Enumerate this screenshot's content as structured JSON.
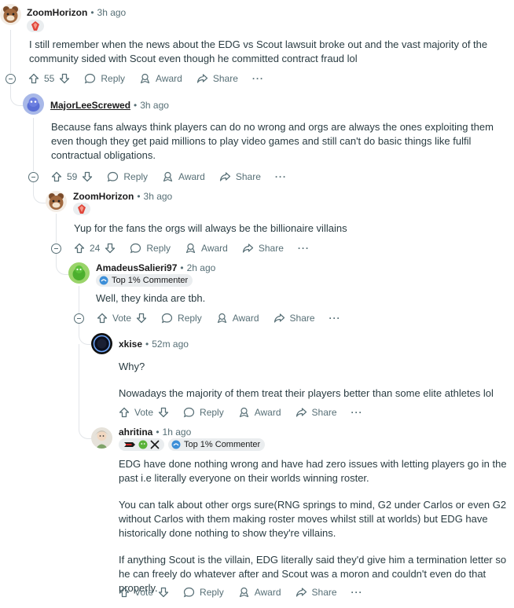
{
  "comments": [
    {
      "username": "ZoomHorizon",
      "time": "3h ago",
      "body": [
        "I still remember when the news about the EDG vs Scout lawsuit broke out and the vast majority of the community sided with Scout even though he committed contract fraud lol"
      ],
      "votes": "55",
      "reply": "Reply",
      "award": "Award",
      "share": "Share",
      "more": "···"
    },
    {
      "username": "MajorLeeScrewed",
      "time": "3h ago",
      "body": [
        "Because fans always think players can do no wrong and orgs are always the ones exploiting them even though they get paid millions to play video games and still can't do basic things like fulfil contractual obligations."
      ],
      "votes": "59",
      "reply": "Reply",
      "award": "Award",
      "share": "Share",
      "more": "···"
    },
    {
      "username": "ZoomHorizon",
      "time": "3h ago",
      "body": [
        "Yup for the fans the orgs will always be the billionaire villains"
      ],
      "votes": "24",
      "reply": "Reply",
      "award": "Award",
      "share": "Share",
      "more": "···"
    },
    {
      "username": "AmadeusSalieri97",
      "time": "2h ago",
      "flair": "Top 1% Commenter",
      "body": [
        "Well, they kinda are tbh."
      ],
      "votes": "Vote",
      "reply": "Reply",
      "award": "Award",
      "share": "Share",
      "more": "···"
    },
    {
      "username": "xkise",
      "time": "52m ago",
      "body": [
        "Why?",
        "Nowadays the majority of them treat their players better than some elite athletes lol"
      ],
      "votes": "Vote",
      "reply": "Reply",
      "award": "Award",
      "share": "Share",
      "more": "···"
    },
    {
      "username": "ahritina",
      "time": "1h ago",
      "flair": "Top 1% Commenter",
      "body": [
        "EDG have done nothing wrong and have had zero issues with letting players go in the past i.e literally everyone on their worlds winning roster.",
        "You can talk about other orgs sure(RNG springs to mind, G2 under Carlos or even G2 without Carlos with them making roster moves whilst still at worlds) but EDG have historically done nothing to show they're villains.",
        "If anything Scout is the villain, EDG literally said they'd give him a termination letter so he can freely do whatever after and Scout was a moron and couldn't even do that properly."
      ],
      "votes": "Vote",
      "reply": "Reply",
      "award": "Award",
      "share": "Share",
      "more": "···"
    }
  ],
  "colors": {
    "accent": "#d93a00",
    "meta": "#576f76",
    "thread": "#e2e5e9",
    "text": "#2a3c42"
  }
}
